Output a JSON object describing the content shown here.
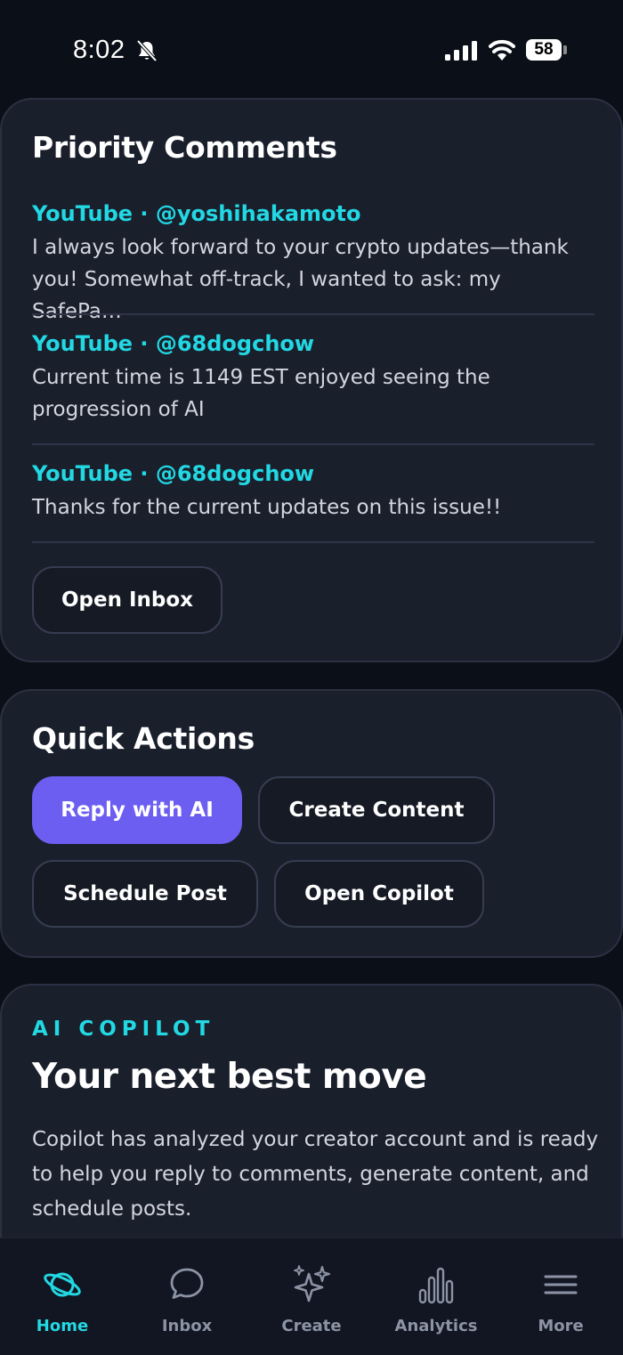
{
  "status_bar": {
    "time": "8:02",
    "battery": "58"
  },
  "priority_comments": {
    "title": "Priority Comments",
    "comments": [
      {
        "source": "YouTube · @yoshihakamoto",
        "text": "I always look forward to your crypto updates—thank you! Somewhat off-track, I wanted to ask: my SafePa…"
      },
      {
        "source": "YouTube · @68dogchow",
        "text": "Current time is 1149 EST enjoyed seeing the progression of AI"
      },
      {
        "source": "YouTube · @68dogchow",
        "text": "Thanks for the current updates on this issue!!"
      }
    ],
    "open_inbox_label": "Open Inbox"
  },
  "quick_actions": {
    "title": "Quick Actions",
    "buttons": [
      "Reply with AI",
      "Create Content",
      "Schedule Post",
      "Open Copilot"
    ]
  },
  "copilot": {
    "eyebrow": "AI COPILOT",
    "headline": "Your next best move",
    "description": "Copilot has analyzed your creator account and is ready to help you reply to comments, generate content, and schedule posts."
  },
  "tab_bar": {
    "tabs": [
      {
        "label": "Home",
        "icon": "planet-icon",
        "active": true
      },
      {
        "label": "Inbox",
        "icon": "chat-icon",
        "active": false
      },
      {
        "label": "Create",
        "icon": "sparkles-icon",
        "active": false
      },
      {
        "label": "Analytics",
        "icon": "bar-chart-icon",
        "active": false
      },
      {
        "label": "More",
        "icon": "menu-icon",
        "active": false
      }
    ]
  },
  "colors": {
    "accent": "#22d8e3",
    "primary_button": "#6d5ef2",
    "card": "#1a1f2c",
    "background": "#0b0f17"
  }
}
